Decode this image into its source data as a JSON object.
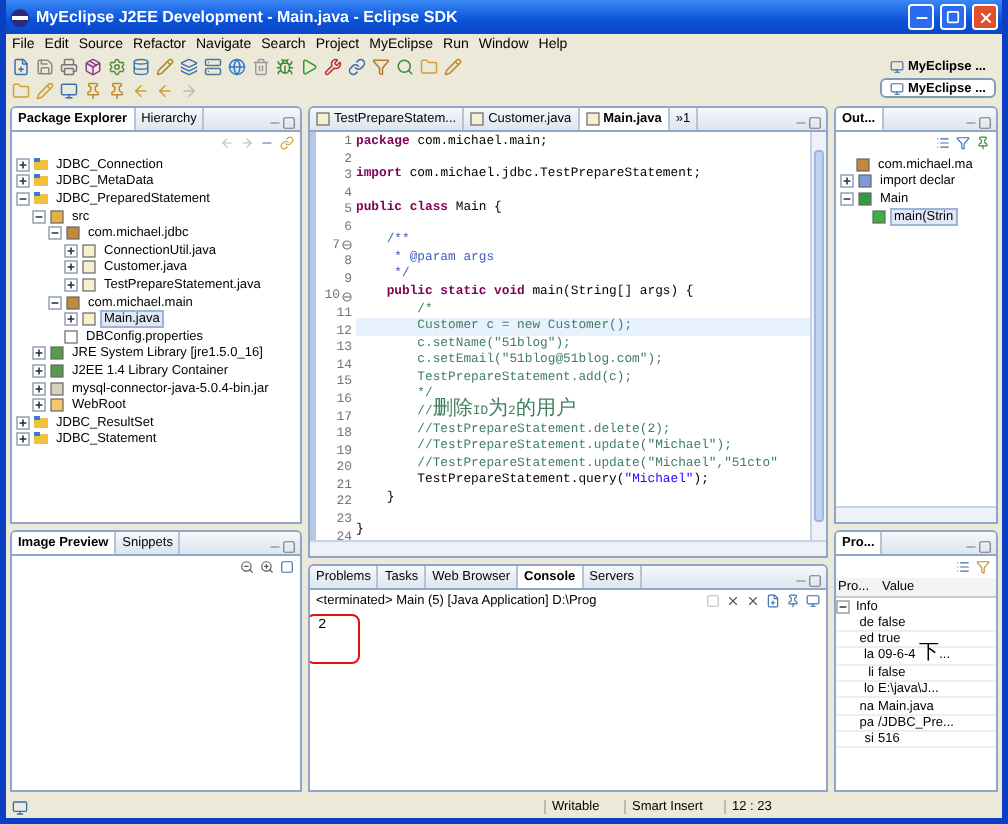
{
  "window": {
    "title": "MyEclipse J2EE Development - Main.java - Eclipse SDK"
  },
  "menu": [
    "File",
    "Edit",
    "Source",
    "Refactor",
    "Navigate",
    "Search",
    "Project",
    "MyEclipse",
    "Run",
    "Window",
    "Help"
  ],
  "perspectives": [
    {
      "label": "MyEclipse ...",
      "selected": false
    },
    {
      "label": "MyEclipse ...",
      "selected": true
    }
  ],
  "package_explorer": {
    "tabs": [
      {
        "label": "Package Explorer",
        "selected": true
      },
      {
        "label": "Hierarchy",
        "selected": false
      }
    ],
    "tree": [
      {
        "label": "JDBC_Connection",
        "kind": "project",
        "expanded": false
      },
      {
        "label": "JDBC_MetaData",
        "kind": "project",
        "expanded": false
      },
      {
        "label": "JDBC_PreparedStatement",
        "kind": "project",
        "expanded": true,
        "children": [
          {
            "label": "src",
            "kind": "srcfolder",
            "expanded": true,
            "children": [
              {
                "label": "com.michael.jdbc",
                "kind": "package",
                "expanded": true,
                "children": [
                  {
                    "label": "ConnectionUtil.java",
                    "kind": "java",
                    "expanded": false,
                    "selected": false
                  },
                  {
                    "label": "Customer.java",
                    "kind": "java",
                    "expanded": false,
                    "selected": false
                  },
                  {
                    "label": "TestPrepareStatement.java",
                    "kind": "java",
                    "expanded": false,
                    "selected": false
                  }
                ]
              },
              {
                "label": "com.michael.main",
                "kind": "package",
                "expanded": true,
                "children": [
                  {
                    "label": "Main.java",
                    "kind": "java",
                    "expanded": false,
                    "selected": true
                  }
                ]
              },
              {
                "label": "DBConfig.properties",
                "kind": "file"
              }
            ]
          },
          {
            "label": "JRE System Library [jre1.5.0_16]",
            "kind": "library",
            "expanded": false
          },
          {
            "label": "J2EE 1.4 Library Container",
            "kind": "library",
            "expanded": false
          },
          {
            "label": "mysql-connector-java-5.0.4-bin.jar",
            "kind": "jar",
            "expanded": false
          },
          {
            "label": "WebRoot",
            "kind": "folder",
            "expanded": false
          }
        ]
      },
      {
        "label": "JDBC_ResultSet",
        "kind": "project",
        "expanded": false
      },
      {
        "label": "JDBC_Statement",
        "kind": "project",
        "expanded": false
      }
    ]
  },
  "image_preview": {
    "tabs": [
      {
        "label": "Image Preview",
        "selected": true
      },
      {
        "label": "Snippets",
        "selected": false
      }
    ]
  },
  "editor": {
    "tabs": [
      {
        "label": "TestPrepareStatem...",
        "selected": false
      },
      {
        "label": "Customer.java",
        "selected": false
      },
      {
        "label": "Main.java",
        "selected": true
      }
    ],
    "overflow": "»1",
    "lines": [
      {
        "num": "1",
        "segments": [
          {
            "kind": "keyword",
            "text": "package"
          },
          {
            "kind": "plain",
            "text": " com.michael.main;"
          }
        ]
      },
      {
        "num": "2"
      },
      {
        "num": "3",
        "segments": [
          {
            "kind": "keyword",
            "text": "import"
          },
          {
            "kind": "plain",
            "text": " com.michael.jdbc.TestPrepareStatement;"
          }
        ]
      },
      {
        "num": "4"
      },
      {
        "num": "5",
        "segments": [
          {
            "kind": "keyword",
            "text": "public class"
          },
          {
            "kind": "plain",
            "text": " Main {"
          }
        ]
      },
      {
        "num": "6"
      },
      {
        "num": "7",
        "fold": true,
        "segments": [
          {
            "kind": "javadoc",
            "text": "    /**"
          }
        ]
      },
      {
        "num": "8",
        "segments": [
          {
            "kind": "javadoc",
            "text": "     * @param args"
          }
        ]
      },
      {
        "num": "9",
        "segments": [
          {
            "kind": "javadoc",
            "text": "     */"
          }
        ]
      },
      {
        "num": "10",
        "fold": true,
        "segments": [
          {
            "kind": "keyword",
            "text": "    public static void"
          },
          {
            "kind": "plain",
            "text": " main(String[] args) {"
          }
        ]
      },
      {
        "num": "11",
        "segments": [
          {
            "kind": "comment",
            "text": "        /*"
          }
        ]
      },
      {
        "num": "12",
        "current": true,
        "segments": [
          {
            "kind": "comment",
            "text": "        Customer c = new Customer();"
          }
        ]
      },
      {
        "num": "13",
        "segments": [
          {
            "kind": "comment",
            "text": "        c.setName(\"51blog\");"
          }
        ]
      },
      {
        "num": "14",
        "segments": [
          {
            "kind": "comment",
            "text": "        c.setEmail(\"51blog@51blog.com\");"
          }
        ]
      },
      {
        "num": "15",
        "segments": [
          {
            "kind": "comment",
            "text": "        TestPrepareStatement.add(c);"
          }
        ]
      },
      {
        "num": "16",
        "segments": [
          {
            "kind": "comment",
            "text": "        */"
          }
        ]
      },
      {
        "num": "17",
        "segments": [
          {
            "kind": "comment",
            "text": "        //删除ID为2的用户"
          }
        ]
      },
      {
        "num": "18",
        "segments": [
          {
            "kind": "comment",
            "text": "        //TestPrepareStatement.delete(2);"
          }
        ]
      },
      {
        "num": "19",
        "segments": [
          {
            "kind": "comment",
            "text": "        //TestPrepareStatement.update(\"Michael\");"
          }
        ]
      },
      {
        "num": "20",
        "segments": [
          {
            "kind": "comment",
            "text": "        //TestPrepareStatement.update(\"Michael\",\"51cto\""
          }
        ]
      },
      {
        "num": "21",
        "segments": [
          {
            "kind": "plain",
            "text": "        TestPrepareStatement.query("
          },
          {
            "kind": "string",
            "text": "\"Michael\""
          },
          {
            "kind": "plain",
            "text": ");"
          }
        ]
      },
      {
        "num": "22",
        "segments": [
          {
            "kind": "plain",
            "text": "    }"
          }
        ]
      },
      {
        "num": "23"
      },
      {
        "num": "24",
        "segments": [
          {
            "kind": "plain",
            "text": "}"
          }
        ]
      }
    ]
  },
  "console": {
    "tabs": [
      {
        "label": "Problems",
        "selected": false
      },
      {
        "label": "Tasks",
        "selected": false
      },
      {
        "label": "Web Browser",
        "selected": false
      },
      {
        "label": "Console",
        "selected": true
      },
      {
        "label": "Servers",
        "selected": false
      }
    ],
    "header": "<terminated> Main (5) [Java Application] D:\\Prog",
    "output": "2"
  },
  "outline": {
    "tabs": [
      {
        "label": "Out...",
        "selected": true
      }
    ],
    "tree": [
      {
        "label": "com.michael.ma",
        "kind": "package"
      },
      {
        "label": "import declar",
        "kind": "imports",
        "expanded": false
      },
      {
        "label": "Main",
        "kind": "class",
        "expanded": true,
        "children": [
          {
            "label": "main(Strin",
            "kind": "method",
            "selected": true
          }
        ]
      }
    ]
  },
  "properties": {
    "tabs": [
      {
        "label": "Pro...",
        "selected": true
      }
    ],
    "columns": [
      "Pro...",
      "Value"
    ],
    "group": "Info",
    "rows": [
      {
        "key": "de",
        "value": "false"
      },
      {
        "key": "ed",
        "value": "true"
      },
      {
        "key": "la",
        "value": "09-6-4 下..."
      },
      {
        "key": "li",
        "value": "false"
      },
      {
        "key": "lo",
        "value": "E:\\java\\J..."
      },
      {
        "key": "na",
        "value": "Main.java"
      },
      {
        "key": "pa",
        "value": "/JDBC_Pre..."
      },
      {
        "key": "si",
        "value": "516"
      }
    ]
  },
  "status_bar": [
    "Writable",
    "Smart Insert",
    "12 : 23"
  ]
}
